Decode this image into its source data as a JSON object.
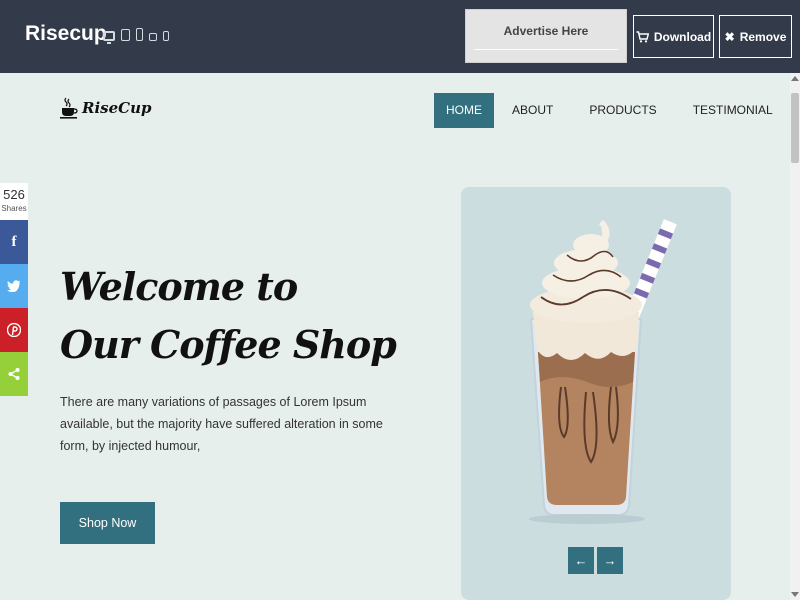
{
  "topbar": {
    "brand": "Risecup",
    "device_icons": [
      "desktop-icon",
      "tablet-icon",
      "phone-icon",
      "tablet-landscape-icon",
      "phone-small-icon"
    ],
    "advertise": "Advertise Here",
    "download_label": "Download",
    "remove_label": "Remove"
  },
  "site": {
    "logo_text": "RiseCup",
    "nav": [
      {
        "label": "HOME",
        "active": true
      },
      {
        "label": "ABOUT",
        "active": false
      },
      {
        "label": "PRODUCTS",
        "active": false
      },
      {
        "label": "TESTIMONIAL",
        "active": false
      }
    ],
    "hero": {
      "title_line1": "Welcome to",
      "title_line2": "Our Coffee Shop",
      "description": "There are many variations of passages of Lorem Ipsum available, but the majority have suffered alteration in some form, by injected humour,",
      "button": "Shop Now"
    },
    "slider": {
      "prev": "←",
      "next": "→"
    }
  },
  "share": {
    "count": "526",
    "label": "Shares",
    "buttons": [
      "facebook-icon",
      "twitter-icon",
      "pinterest-icon",
      "share-icon"
    ]
  },
  "colors": {
    "topbar": "#333b4b",
    "accent": "#33707f",
    "page_bg": "#e7efec",
    "card_bg": "#ccdde0"
  }
}
